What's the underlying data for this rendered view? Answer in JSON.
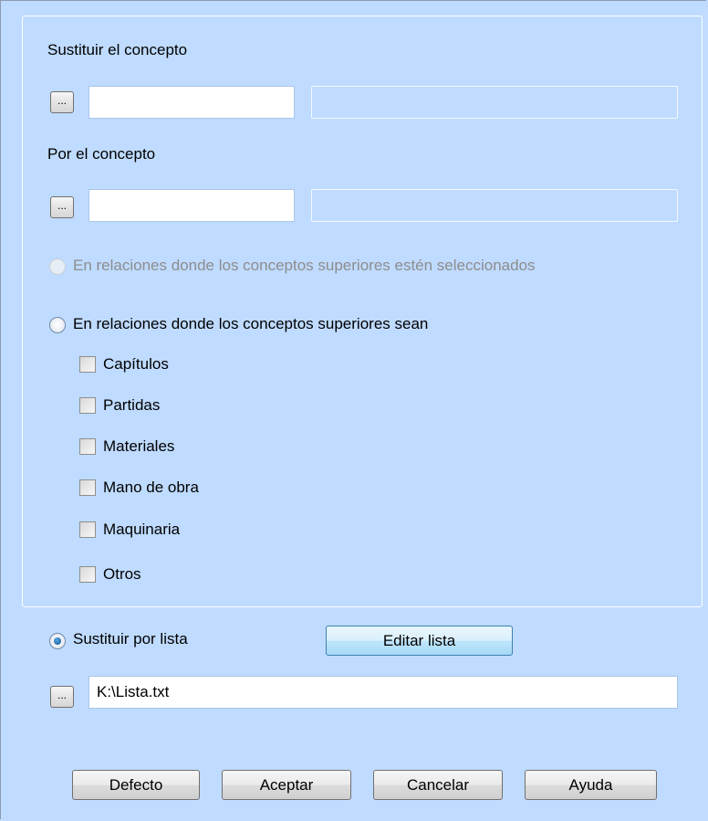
{
  "group": {
    "replace_label": "Sustituir el concepto",
    "replace_browse": "...",
    "replace_code": "",
    "replace_desc": "",
    "by_label": "Por el concepto",
    "by_browse": "...",
    "by_code": "",
    "by_desc": "",
    "radio_selected_label": "En relaciones donde los conceptos superiores estén seleccionados",
    "radio_types_label": "En relaciones donde los conceptos superiores sean",
    "checkboxes": [
      {
        "label": "Capítulos",
        "checked": false
      },
      {
        "label": "Partidas",
        "checked": false
      },
      {
        "label": "Materiales",
        "checked": false
      },
      {
        "label": "Mano de obra",
        "checked": false
      },
      {
        "label": "Maquinaria",
        "checked": false
      },
      {
        "label": "Otros",
        "checked": false
      }
    ]
  },
  "list": {
    "radio_label": "Sustituir por lista",
    "radio_checked": true,
    "edit_button": "Editar lista",
    "browse": "...",
    "path": "K:\\Lista.txt"
  },
  "buttons": {
    "default": "Defecto",
    "accept": "Aceptar",
    "cancel": "Cancelar",
    "help": "Ayuda"
  }
}
